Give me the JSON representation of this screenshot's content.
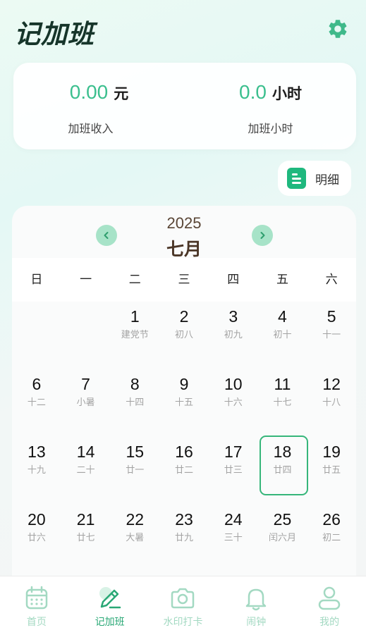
{
  "app": {
    "title": "记加班"
  },
  "summary": {
    "income": {
      "value": "0.00",
      "unit": "元",
      "label": "加班收入"
    },
    "hours": {
      "value": "0.0",
      "unit": "小时",
      "label": "加班小时"
    }
  },
  "detail_button": {
    "label": "明细"
  },
  "calendar": {
    "year": "2025",
    "month": "七月",
    "weekdays": [
      "日",
      "一",
      "二",
      "三",
      "四",
      "五",
      "六"
    ],
    "weeks": [
      [
        {
          "d": "",
          "l": ""
        },
        {
          "d": "",
          "l": ""
        },
        {
          "d": "1",
          "l": "建党节"
        },
        {
          "d": "2",
          "l": "初八"
        },
        {
          "d": "3",
          "l": "初九"
        },
        {
          "d": "4",
          "l": "初十"
        },
        {
          "d": "5",
          "l": "十一"
        }
      ],
      [
        {
          "d": "6",
          "l": "十二"
        },
        {
          "d": "7",
          "l": "小暑"
        },
        {
          "d": "8",
          "l": "十四"
        },
        {
          "d": "9",
          "l": "十五"
        },
        {
          "d": "10",
          "l": "十六"
        },
        {
          "d": "11",
          "l": "十七"
        },
        {
          "d": "12",
          "l": "十八"
        }
      ],
      [
        {
          "d": "13",
          "l": "十九"
        },
        {
          "d": "14",
          "l": "二十"
        },
        {
          "d": "15",
          "l": "廿一"
        },
        {
          "d": "16",
          "l": "廿二"
        },
        {
          "d": "17",
          "l": "廿三"
        },
        {
          "d": "18",
          "l": "廿四",
          "today": true
        },
        {
          "d": "19",
          "l": "廿五"
        }
      ],
      [
        {
          "d": "20",
          "l": "廿六"
        },
        {
          "d": "21",
          "l": "廿七"
        },
        {
          "d": "22",
          "l": "大暑"
        },
        {
          "d": "23",
          "l": "廿九"
        },
        {
          "d": "24",
          "l": "三十"
        },
        {
          "d": "25",
          "l": "闰六月"
        },
        {
          "d": "26",
          "l": "初二"
        }
      ]
    ]
  },
  "tabbar": {
    "items": [
      {
        "label": "首页",
        "icon": "calendar-icon"
      },
      {
        "label": "记加班",
        "icon": "edit-icon",
        "active": true
      },
      {
        "label": "水印打卡",
        "icon": "camera-icon"
      },
      {
        "label": "闹钟",
        "icon": "bell-icon"
      },
      {
        "label": "我的",
        "icon": "user-icon"
      }
    ]
  },
  "colors": {
    "accent": "#3bbf8e",
    "today_border": "#36b67a",
    "tab_inactive": "#a3d9c2"
  }
}
